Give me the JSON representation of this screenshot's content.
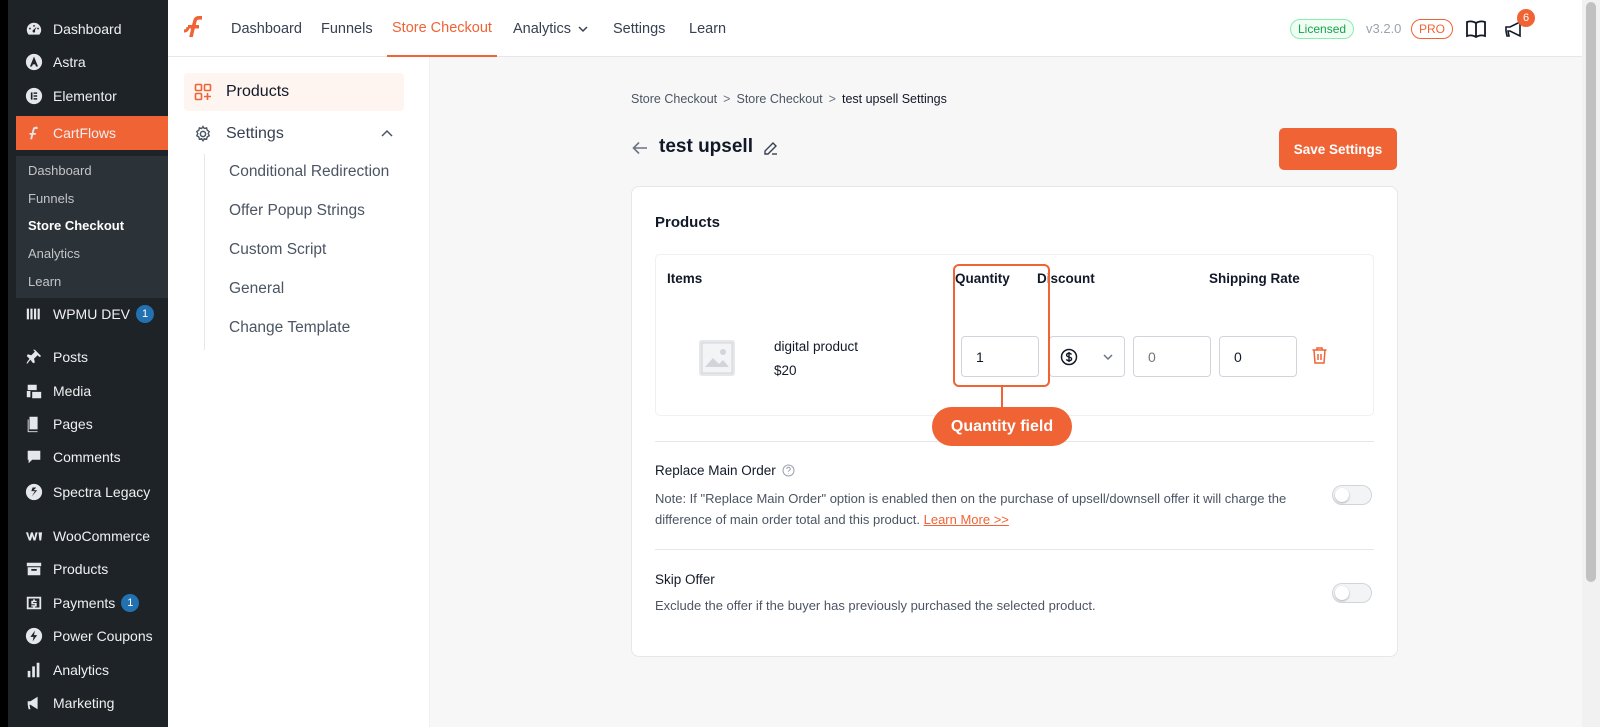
{
  "wp_sidebar": {
    "items": [
      {
        "label": "Dashboard",
        "icon": "dashboard-icon"
      },
      {
        "label": "Astra",
        "icon": "astra-icon"
      },
      {
        "label": "Elementor",
        "icon": "elementor-icon"
      },
      {
        "label": "CartFlows",
        "icon": "cartflows-icon"
      },
      {
        "label": "WPMU DEV",
        "icon": "wpmudev-icon",
        "badge": "1"
      },
      {
        "label": "Posts",
        "icon": "pin-icon"
      },
      {
        "label": "Media",
        "icon": "media-icon"
      },
      {
        "label": "Pages",
        "icon": "pages-icon"
      },
      {
        "label": "Comments",
        "icon": "comments-icon"
      },
      {
        "label": "Spectra Legacy",
        "icon": "spectra-icon"
      },
      {
        "label": "WooCommerce",
        "icon": "woocommerce-icon"
      },
      {
        "label": "Products",
        "icon": "archive-icon"
      },
      {
        "label": "Payments",
        "icon": "payments-icon",
        "badge": "1"
      },
      {
        "label": "Power Coupons",
        "icon": "power-coupons-icon"
      },
      {
        "label": "Analytics",
        "icon": "bar-chart-icon"
      },
      {
        "label": "Marketing",
        "icon": "megaphone-icon"
      }
    ],
    "submenu": [
      "Dashboard",
      "Funnels",
      "Store Checkout",
      "Analytics",
      "Learn"
    ]
  },
  "topbar": {
    "nav": [
      "Dashboard",
      "Funnels",
      "Store Checkout",
      "Analytics",
      "Settings",
      "Learn"
    ],
    "licensed": "Licensed",
    "version": "v3.2.0",
    "pro": "PRO",
    "notifications": "6"
  },
  "left_nav": {
    "products": "Products",
    "settings": "Settings",
    "sub": [
      "Conditional Redirection",
      "Offer Popup Strings",
      "Custom Script",
      "General",
      "Change Template"
    ]
  },
  "breadcrumb": [
    "Store Checkout",
    ">",
    "Store Checkout",
    ">",
    "test upsell Settings"
  ],
  "page": {
    "title": "test upsell",
    "save": "Save Settings"
  },
  "products": {
    "title": "Products",
    "headers": [
      "Items",
      "Quantity",
      "Discount",
      "Shipping Rate"
    ],
    "row": {
      "name": "digital product",
      "price": "$20",
      "quantity": "1",
      "discount_placeholder": "0",
      "shipping": "0"
    }
  },
  "annotation": {
    "label": "Quantity field"
  },
  "options": {
    "replace": {
      "title": "Replace Main Order",
      "note": "Note: If \"Replace Main Order\" option is enabled then on the purchase of upsell/downsell offer it will charge the difference of main order total and this product.",
      "link": "Learn More >>",
      "enabled": false
    },
    "skip": {
      "title": "Skip Offer",
      "note": "Exclude the offer if the buyer has previously purchased the selected product.",
      "enabled": false
    }
  },
  "colors": {
    "accent": "#f06335",
    "sidebar_bg": "#1d2327"
  }
}
